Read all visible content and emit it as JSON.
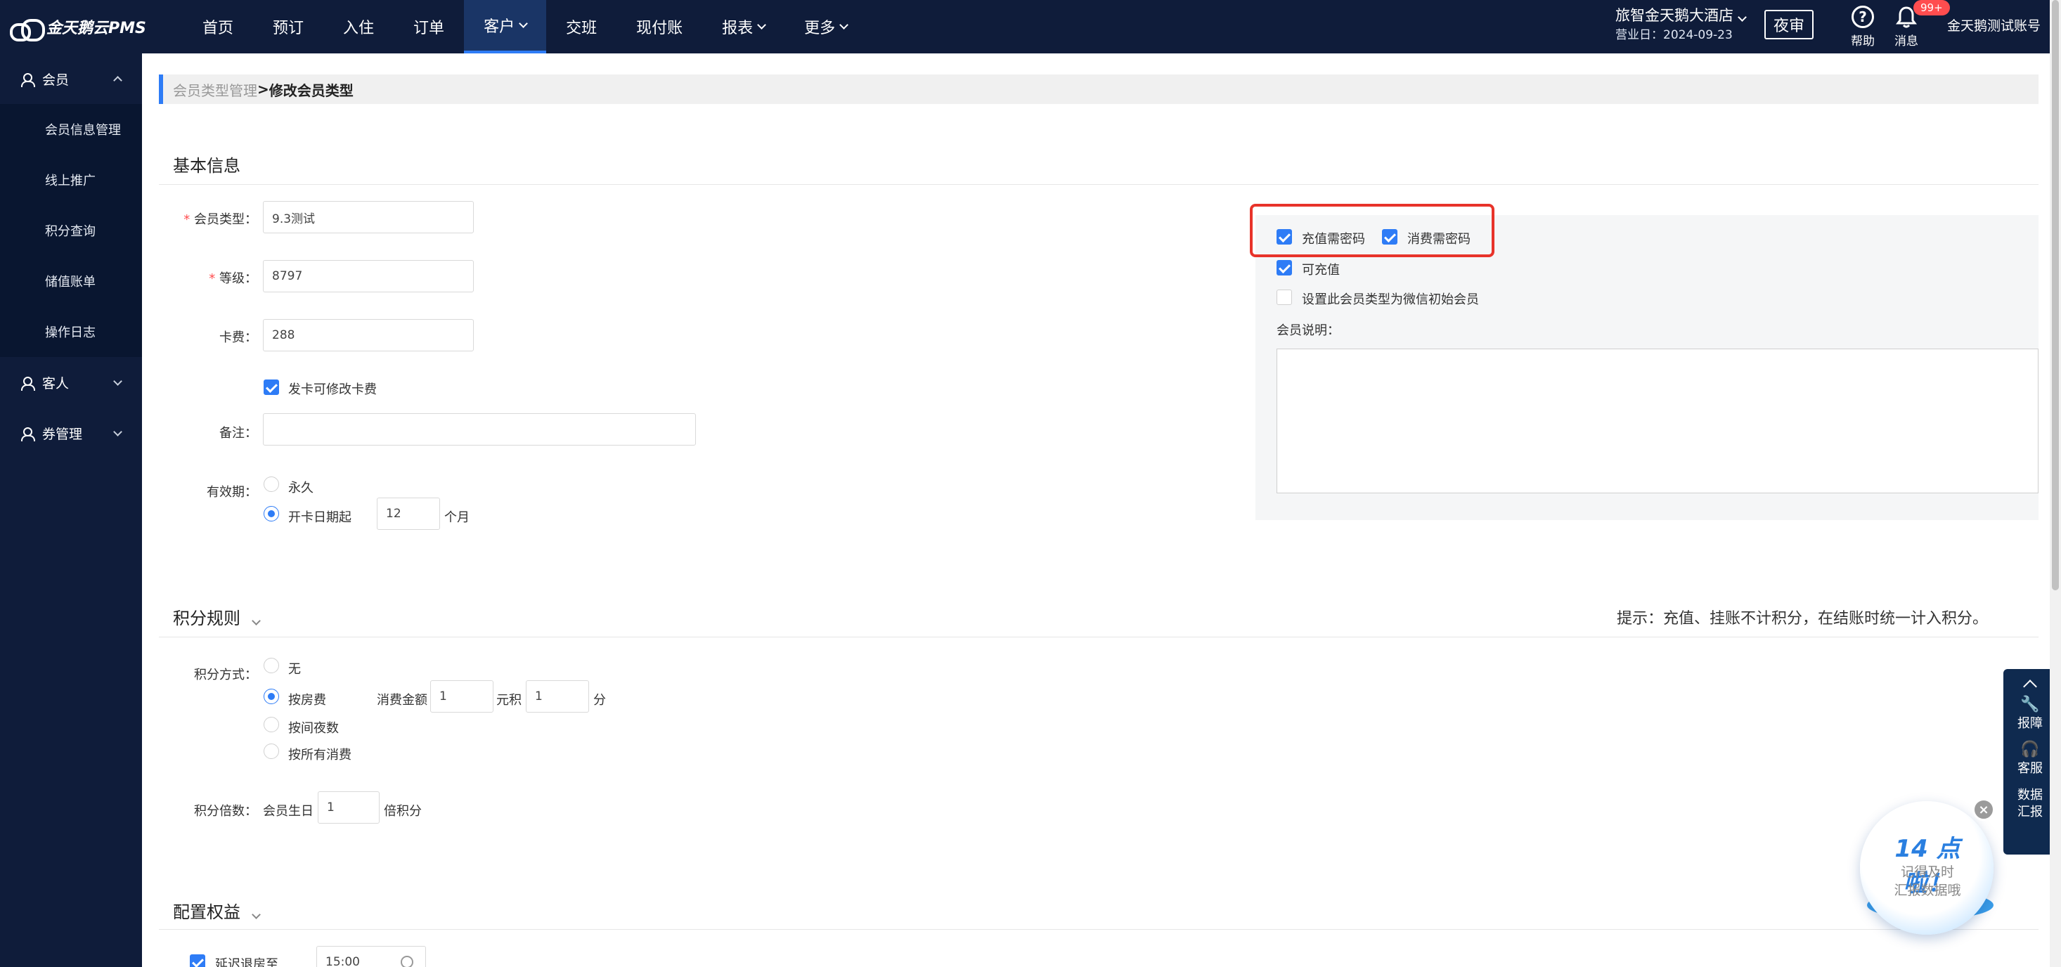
{
  "brand": {
    "name": "金天鹅云PMS"
  },
  "nav": {
    "items": [
      "首页",
      "预订",
      "入住",
      "订单",
      "客户",
      "交班",
      "现付账",
      "报表",
      "更多"
    ],
    "active": "客户"
  },
  "hotel": {
    "name": "旅智金天鹅大酒店",
    "business_date": "营业日：2024-09-23"
  },
  "night_audit": "夜审",
  "tools": {
    "help": "帮助",
    "messages": "消息",
    "badge": "99+"
  },
  "account": "金天鹅测试账号",
  "sidebar": {
    "groups": [
      {
        "label": "会员",
        "items": [
          "会员信息管理",
          "线上推广",
          "积分查询",
          "储值账单",
          "操作日志"
        ]
      },
      {
        "label": "客人"
      },
      {
        "label": "券管理"
      }
    ]
  },
  "breadcrumb": {
    "parent": "会员类型管理",
    "sep": " > ",
    "current": "修改会员类型"
  },
  "basic": {
    "title": "基本信息",
    "type_label": "会员类型：",
    "type_value": "9.3测试",
    "level_label": "等级：",
    "level_value": "8797",
    "fee_label": "卡费：",
    "fee_value": "288",
    "fee_editable": "发卡可修改卡费",
    "note_label": "备注：",
    "validity_label": "有效期：",
    "validity_forever": "永久",
    "validity_from": "开卡日期起",
    "validity_months": "12",
    "validity_unit": "个月"
  },
  "right": {
    "recharge_pwd": "充值需密码",
    "consume_pwd": "消费需密码",
    "rechargeable": "可充值",
    "wechat_default": "设置此会员类型为微信初始会员",
    "desc_label": "会员说明："
  },
  "points": {
    "title": "积分规则",
    "tip": "提示：充值、挂账不计积分，在结账时统一计入积分。",
    "method_label": "积分方式：",
    "opt_none": "无",
    "opt_room": "按房费",
    "opt_nights": "按间夜数",
    "opt_all": "按所有消费",
    "spend_label": "消费金额",
    "spend_value": "1",
    "yuan_label": "元积",
    "points_value": "1",
    "points_unit": "分",
    "multiplier_label": "积分倍数：",
    "birthday_label": "会员生日",
    "birthday_value": "1",
    "multiplier_unit": "倍积分"
  },
  "benefits": {
    "title": "配置权益",
    "late_checkout": "延迟退房至",
    "late_time": "15:00"
  },
  "float_bar": {
    "report": "报障",
    "service": "客服",
    "data_line1": "数据",
    "data_line2": "汇报"
  },
  "bubble": {
    "title": "14 点啦！",
    "line1": "记得及时",
    "line2": "汇报数据哦"
  }
}
